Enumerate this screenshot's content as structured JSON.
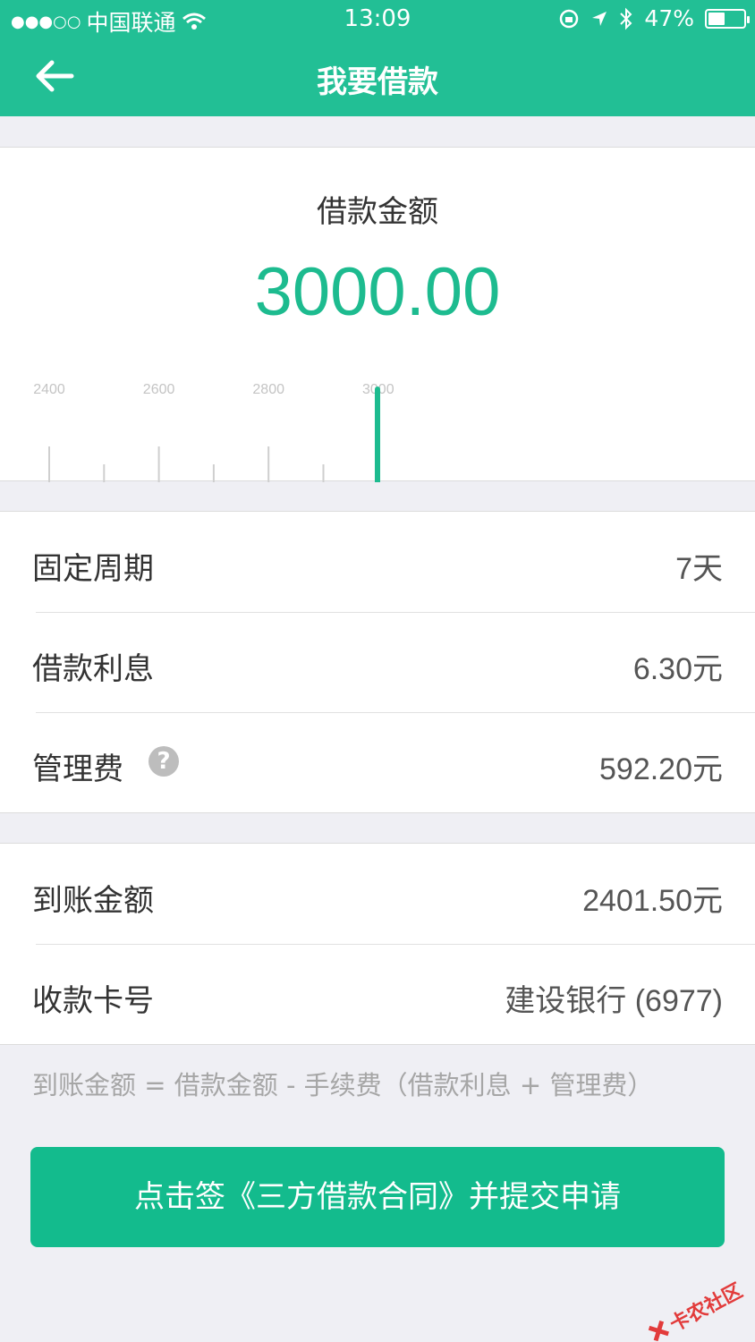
{
  "status_bar": {
    "carrier": "中国联通",
    "time": "13:09",
    "battery": "47%",
    "battery_level": 0.47
  },
  "nav": {
    "title": "我要借款"
  },
  "amount": {
    "label": "借款金额",
    "value": "3000.00",
    "ruler_ticks": [
      "2400",
      "2600",
      "2800",
      "3000"
    ],
    "accent_color": "#1dbb8f"
  },
  "details": [
    {
      "label": "固定周期",
      "value": "7天"
    },
    {
      "label": "借款利息",
      "value": "6.30元"
    },
    {
      "label": "管理费",
      "value": "592.20元"
    }
  ],
  "receive": [
    {
      "label": "到账金额",
      "value": "2401.50元"
    },
    {
      "label": "收款卡号",
      "value": "建设银行 (6977)"
    }
  ],
  "formula": "到账金额 = 借款金额 - 手续费（借款利息 + 管理费）",
  "submit_label": "点击签《三方借款合同》并提交申请",
  "watermark": "卡农社区",
  "colors": {
    "nav_bg": "#22bf95",
    "button_bg": "#13bb8d"
  }
}
